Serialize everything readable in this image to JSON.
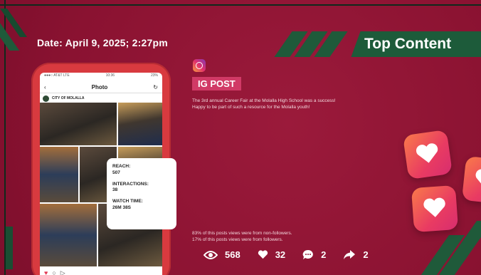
{
  "slide": {
    "date": "Date: April 9, 2025; 2:27pm",
    "section_title": "Top Content",
    "badge": "IG POST",
    "description": "The 3rd annual Career Fair at the Molalla High School was a success! Happy to be part of such a resource for the Molalla youth!",
    "notes": [
      "83% of this posts views were from non-followers.",
      "17% of this posts views were from followers."
    ]
  },
  "phone": {
    "status_left": "●●●○ AT&T LTE",
    "status_center": "10:36",
    "status_right": "23%",
    "nav_back": "‹",
    "nav_title": "Photo",
    "nav_refresh": "↻",
    "account_name": "CITY OF MOLALLA",
    "bottom_heart": "♥",
    "bottom_comment": "○",
    "bottom_share": "▷"
  },
  "metrics_card": {
    "reach_label": "REACH:",
    "reach_value": "507",
    "interactions_label": "INTERACTIONS:",
    "interactions_value": "38",
    "watch_label": "WATCH TIME:",
    "watch_value": "26M 38S"
  },
  "stats": {
    "views": "568",
    "likes": "32",
    "comments": "2",
    "shares": "2"
  },
  "colors": {
    "background": "#8f1535",
    "accent_green": "#1d5b3a",
    "badge_pink": "#d13a66",
    "phone_red": "#d83a3f"
  },
  "icons": [
    "instagram-logo-icon",
    "eye-icon",
    "heart-icon",
    "comment-icon",
    "share-arrow-icon",
    "heart-tile-icon"
  ]
}
